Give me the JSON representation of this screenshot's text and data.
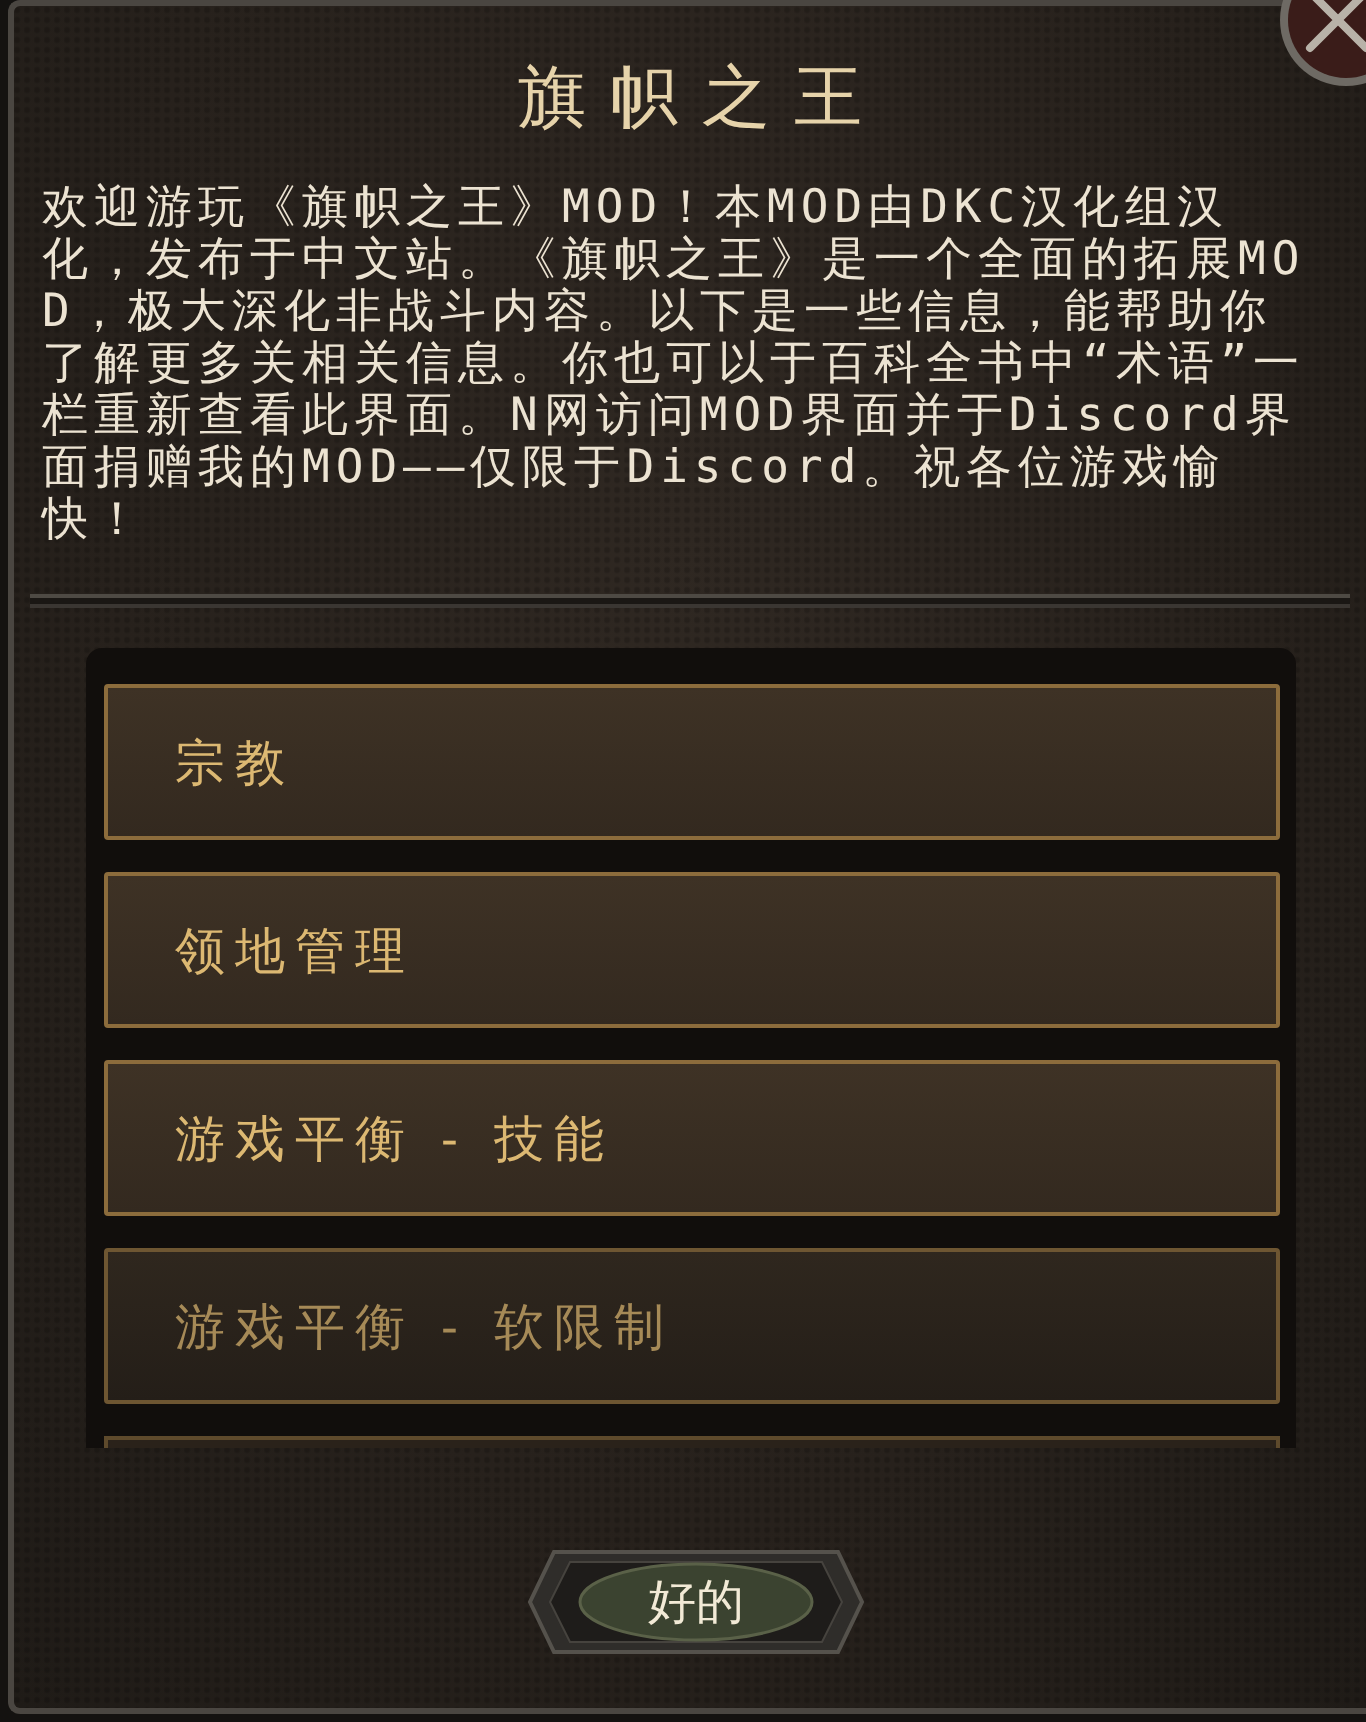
{
  "dialog": {
    "title": "旗帜之王",
    "description": "欢迎游玩《旗帜之王》MOD！本MOD由DKC汉化组汉化，发布于中文站。《旗帜之王》是一个全面的拓展MOD，极大深化非战斗内容。以下是一些信息，能帮助你了解更多关相关信息。你也可以于百科全书中“术语”一栏重新查看此界面。N网访问MOD界面并于Discord界面捐赠我的MOD——仅限于Discord。祝各位游戏愉快！"
  },
  "list": {
    "items": [
      {
        "label": "宗教",
        "dimmed": false
      },
      {
        "label": "领地管理",
        "dimmed": false
      },
      {
        "label": "游戏平衡 - 技能",
        "dimmed": false
      },
      {
        "label": "游戏平衡 - 软限制",
        "dimmed": true
      }
    ],
    "more_below": true
  },
  "ok_button": {
    "label": "好的"
  }
}
